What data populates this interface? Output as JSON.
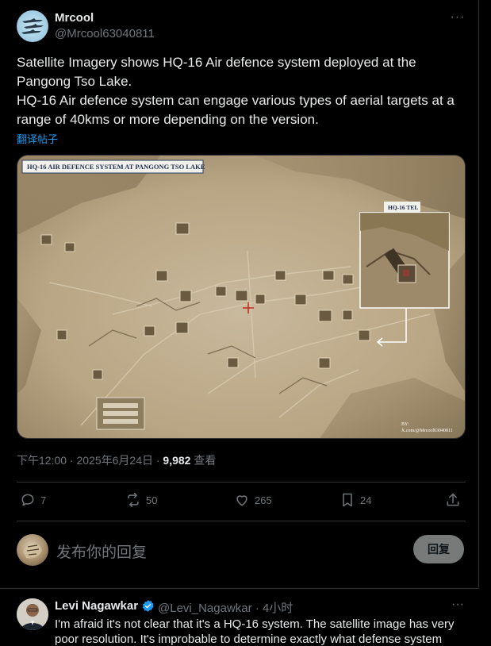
{
  "post": {
    "author_name": "Mrcool",
    "author_handle": "@Mrcool63040811",
    "more_label": "···",
    "text": "Satellite Imagery shows HQ-16 Air defence system deployed at the Pangong Tso Lake.\nHQ-16 Air defence system can engage various types of aerial targets at a range of 40kms or more depending on the version.",
    "translate_label": "翻译帖子",
    "media": {
      "title_label": "HQ-16 AIR DEFENCE SYSTEM AT PANGONG TSO LAKE",
      "inset_label": "HQ-16 TEL",
      "credit_line1": "BY:",
      "credit_line2": "X.com/@Mrcool63040811"
    },
    "timestamp": "下午12:00 · 2025年6月24日 · ",
    "views_count": "9,982",
    "views_label": " 查看",
    "actions": {
      "replies": "7",
      "reposts": "50",
      "likes": "265",
      "bookmarks": "24"
    }
  },
  "reply_box": {
    "placeholder": "发布你的回复",
    "button_label": "回复"
  },
  "reply": {
    "author_name": "Levi Nagawkar",
    "author_handle": "@Levi_Nagawkar · 4小时",
    "more_label": "···",
    "text": "I'm afraid it's not clear that it's a HQ-16 system. The satellite image has very poor resolution. It's improbable to determine exactly what defense system"
  },
  "colors": {
    "background": "#000000",
    "text_primary": "#e7e9ea",
    "text_secondary": "#71767b",
    "accent": "#1d9bf0",
    "border": "#2f3336"
  },
  "icons": [
    "reply-icon",
    "repost-icon",
    "like-icon",
    "bookmark-icon",
    "share-icon",
    "verified-icon",
    "more-icon"
  ]
}
